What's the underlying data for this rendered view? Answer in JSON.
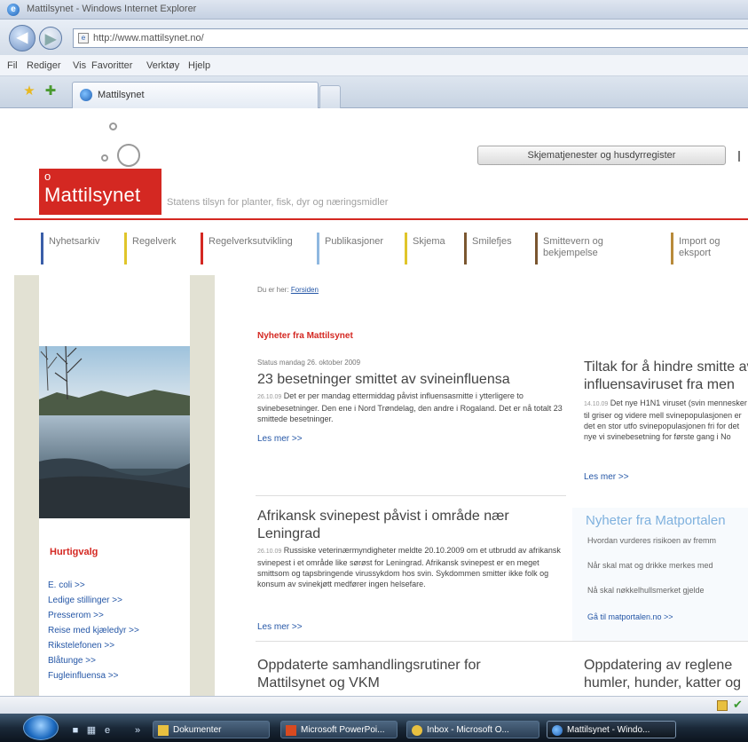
{
  "window": {
    "title": "Mattilsynet - Windows Internet Explorer",
    "url": "http://www.mattilsynet.no/"
  },
  "menu": [
    "Fil",
    "Rediger",
    "Vis",
    "Favoritter",
    "Verktøy",
    "Hjelp"
  ],
  "tab": {
    "label": "Mattilsynet"
  },
  "site": {
    "logo_text": "Mattilsynet",
    "tagline": "Statens tilsyn for planter, fisk, dyr og næringsmidler",
    "top_button": "Skjematjenester og husdyrregister"
  },
  "nav": [
    {
      "label": "Nyhetsarkiv",
      "color": "#3a5ea8"
    },
    {
      "label": "Regelverk",
      "color": "#e0c52a"
    },
    {
      "label": "Regelverksutvikling",
      "color": "#d42822"
    },
    {
      "label": "Publikasjoner",
      "color": "#8fb8e0"
    },
    {
      "label": "Skjema",
      "color": "#e0c52a"
    },
    {
      "label": "Smilefjes",
      "color": "#7a5630"
    },
    {
      "label": "Smittevern og bekjempelse",
      "color": "#7a5630"
    },
    {
      "label": "Import og eksport",
      "color": "#b88a3a"
    }
  ],
  "breadcrumb": {
    "prefix": "Du er her:",
    "link": "Forsiden"
  },
  "news_heading": "Nyheter fra Mattilsynet",
  "news": [
    {
      "meta": "Status mandag 26. oktober 2009",
      "title": "23 besetninger smittet av svineinfluensa",
      "date": "26.10.09",
      "body": "Det er per mandag ettermiddag påvist influensasmitte i ytterligere to svinebesetninger. Den ene i Nord Trøndelag, den andre i Rogaland. Det er nå totalt 23 smittede besetninger.",
      "more": "Les mer >>"
    },
    {
      "title": "Tiltak for å hindre smitte av influensaviruset fra men",
      "date": "14.10.09",
      "body": "Det nye H1N1 viruset (svin mennesker til griser og videre mell svinepopulasjonen er det en stor utfo svinepopulasjonen fri for det nye vi svinebesetning for første gang i No",
      "more": "Les mer >>"
    },
    {
      "title": "Afrikansk svinepest påvist i område nær Leningrad",
      "date": "26.10.09",
      "body": "Russiske veterinærmyndigheter meldte 20.10.2009 om et utbrudd av afrikansk svinepest i et område like sørøst for Leningrad. Afrikansk svinepest er en meget smittsom og tapsbringende virussykdom hos svin. Sykdommen smitter ikke folk og konsum av svinekjøtt medfører ingen helsefare.",
      "more": "Les mer >>"
    },
    {
      "title": "Oppdaterte samhandlingsrutiner for Mattilsynet og VKM"
    },
    {
      "title": "Oppdatering av reglene humler, hunder, katter og"
    }
  ],
  "matportalen": {
    "title": "Nyheter fra Matportalen",
    "links": [
      "Hvordan vurderes risikoen av fremm",
      "Når skal mat og drikke merkes med",
      "Nå skal nøkkelhullsmerket gjelde",
      "Gå til matportalen.no >>"
    ]
  },
  "snarveier": {
    "title": "Hurtigvalg",
    "links": [
      "E. coli >>",
      "Ledige stillinger >>",
      "Presserom >>",
      "Reise med kjæledyr >>",
      "Rikstelefonen >>",
      "Blåtunge >>",
      "Fugleinfluensa >>"
    ]
  },
  "taskbar": [
    {
      "label": "Dokumenter"
    },
    {
      "label": "Microsoft PowerPoi..."
    },
    {
      "label": "Inbox - Microsoft O..."
    },
    {
      "label": "Mattilsynet - Windo..."
    }
  ]
}
